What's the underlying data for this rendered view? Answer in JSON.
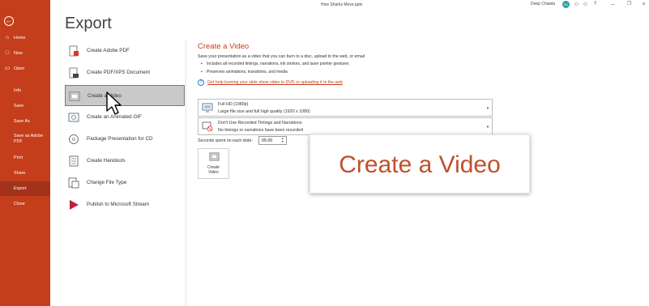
{
  "titlebar": {
    "document_name": "How Sharks Move.pptx",
    "user_name": "Deep Chawla",
    "user_initials": "DC",
    "icons": [
      "emoji-icon",
      "feedback-icon",
      "help-icon",
      "minimize-icon",
      "restore-icon",
      "close-icon"
    ]
  },
  "rail": {
    "items": [
      {
        "label": "Home",
        "icon": "home-icon"
      },
      {
        "label": "New",
        "icon": "new-file-icon"
      },
      {
        "label": "Open",
        "icon": "folder-icon"
      },
      {
        "label": "Info"
      },
      {
        "label": "Save"
      },
      {
        "label": "Save As"
      },
      {
        "label": "Save as Adobe",
        "label2": "PDF"
      },
      {
        "label": "Print"
      },
      {
        "label": "Share"
      },
      {
        "label": "Export",
        "active": true
      },
      {
        "label": "Close"
      }
    ],
    "accent": "#c43e1c"
  },
  "page_title": "Export",
  "options": [
    {
      "label": "Create Adobe PDF",
      "icon": "adobe-pdf-icon"
    },
    {
      "label": "Create PDF/XPS Document",
      "icon": "pdf-xps-icon"
    },
    {
      "label": "Create a Video",
      "icon": "video-icon",
      "selected": true
    },
    {
      "label": "Create an Animated GIF",
      "icon": "gif-icon"
    },
    {
      "label": "Package Presentation for CD",
      "icon": "cd-package-icon"
    },
    {
      "label": "Create Handouts",
      "icon": "handouts-icon"
    },
    {
      "label": "Change File Type",
      "icon": "change-file-type-icon"
    },
    {
      "label": "Publish to Microsoft Stream",
      "icon": "stream-icon"
    }
  ],
  "pane": {
    "title": "Create a Video",
    "description": "Save your presentation as a video that you can burn to a disc, upload to the web, or email",
    "bullets": [
      "Includes all recorded timings, narrations, ink strokes, and laser pointer gestures",
      "Preserves animations, transitions, and media"
    ],
    "help_link": "Get help burning your slide show video to DVD or uploading it to the web",
    "quality": {
      "line1": "Full HD (1080p)",
      "line2": "Large file size and full high quality (1920 x 1080)"
    },
    "timings": {
      "line1": "Don't Use Recorded Timings and Narrations",
      "line2": "No timings or narrations have been recorded"
    },
    "seconds_label": "Seconds spent on each slide:",
    "seconds_value": "05.00",
    "create_button": {
      "line1": "Create",
      "line2": "Video"
    }
  },
  "callout_text": "Create a Video"
}
